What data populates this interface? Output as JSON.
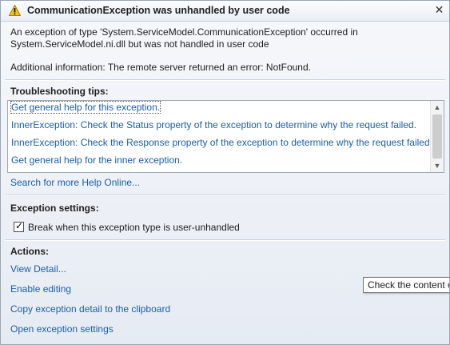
{
  "dialog": {
    "title": "CommunicationException was unhandled by user code",
    "close_glyph": "✕",
    "icon": "warning-icon"
  },
  "message": {
    "line1": "An exception of type 'System.ServiceModel.CommunicationException' occurred in",
    "line2": "System.ServiceModel.ni.dll but was not handled in user code",
    "additional": "Additional information: The remote server returned an error: NotFound."
  },
  "troubleshooting": {
    "heading": "Troubleshooting tips:",
    "tips": [
      "Get general help for this exception.",
      "InnerException: Check the Status property of the exception to determine why the request failed.",
      "InnerException: Check the Response property of the exception to determine why the request failed.",
      "Get general help for the inner exception."
    ],
    "search_link": "Search for more Help Online..."
  },
  "exception_settings": {
    "heading": "Exception settings:",
    "checkbox_label": "Break when this exception type is user-unhandled",
    "checked": true
  },
  "actions": {
    "heading": "Actions:",
    "items": [
      "View Detail...",
      "Enable editing",
      "Copy exception detail to the clipboard",
      "Open exception settings"
    ]
  },
  "tooltip": {
    "text": "Check the content o"
  }
}
